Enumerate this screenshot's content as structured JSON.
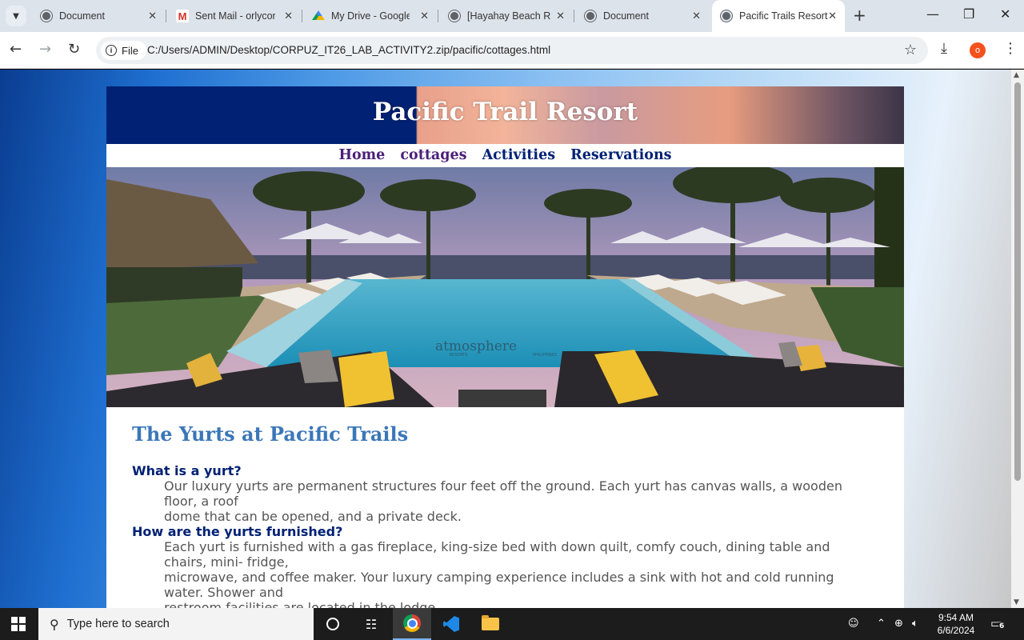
{
  "browser": {
    "tabs": [
      {
        "title": "Document",
        "favicon": "globe-icon"
      },
      {
        "title": "Sent Mail - orlycorpuz",
        "favicon": "gmail-icon"
      },
      {
        "title": "My Drive - Google Drive",
        "favicon": "google-drive-icon"
      },
      {
        "title": "[Hayahay Beach Resort",
        "favicon": "globe-icon"
      },
      {
        "title": "Document",
        "favicon": "globe-icon"
      },
      {
        "title": "Pacific Trails Resort",
        "favicon": "globe-icon",
        "active": true
      }
    ],
    "new_tab_label": "+",
    "window_controls": {
      "minimize": "—",
      "restore": "❐",
      "close": "✕"
    },
    "toolbar": {
      "back": "←",
      "forward": "→",
      "reload": "↻"
    },
    "address": {
      "scheme_label": "File",
      "url": "C:/Users/ADMIN/Desktop/CORPUZ_IT26_LAB_ACTIVITY2.zip/pacific/cottages.html"
    },
    "profile_initial": "o",
    "accent_color": "#f4511e"
  },
  "page": {
    "site_title": "Pacific Trail Resort",
    "nav": [
      {
        "label": "Home",
        "state": "visited"
      },
      {
        "label": "cottages",
        "state": "visited"
      },
      {
        "label": "Activities",
        "state": "link"
      },
      {
        "label": "Reservations",
        "state": "link"
      }
    ],
    "hero_watermark": {
      "brand": "atmosphere",
      "sub_left": "RESORTS",
      "sub_right": "PHILIPPINES"
    },
    "heading": "The Yurts at Pacific Trails",
    "faq": [
      {
        "question": "What is a yurt?",
        "answer_lines": [
          "Our luxury yurts are permanent structures four feet off the ground. Each yurt has canvas walls, a wooden floor, a roof",
          "dome that can be opened, and a private deck."
        ]
      },
      {
        "question": "How are the yurts furnished?",
        "answer_lines": [
          "Each yurt is furnished with a gas fireplace, king-size bed with down quilt, comfy couch, dining table and chairs, mini- fridge,",
          "microwave, and coffee maker. Your luxury camping experience includes a sink with hot and cold running water. Shower and",
          "restroom facilities are located in the lodge."
        ]
      }
    ],
    "colors": {
      "header_blue": "#002174",
      "heading_blue": "#3b77b8",
      "nav_visited": "#4b1f78",
      "nav_link": "#002174"
    }
  },
  "taskbar": {
    "search_placeholder": "Type here to search",
    "time": "9:54 AM",
    "date": "6/6/2024",
    "notification_count": "6"
  }
}
